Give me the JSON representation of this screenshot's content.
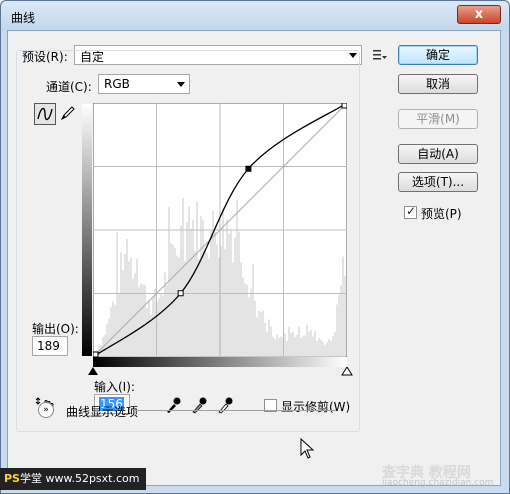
{
  "window": {
    "title": "曲线",
    "close_glyph": "x"
  },
  "preset": {
    "label": "预设(R):",
    "value": "自定"
  },
  "preset_menu_icon": "list-menu-icon",
  "channel": {
    "label": "通道(C):",
    "value": "RGB"
  },
  "buttons": {
    "ok": "确定",
    "cancel": "取消",
    "smooth": "平滑(M)",
    "auto": "自动(A)",
    "options": "选项(T)..."
  },
  "preview": {
    "label": "预览(P)",
    "checked": true
  },
  "output": {
    "label": "输出(O):",
    "value": "189"
  },
  "input": {
    "label": "输入(I):",
    "value": "156"
  },
  "show_clipping": {
    "label": "显示修剪(W)",
    "checked": false
  },
  "curve_display_options": {
    "label": "曲线显示选项"
  },
  "watermarks": {
    "left_ps": "PS",
    "left_rest": "学堂 www.52psxt.com",
    "right": "查字典 教程网",
    "right_sub": "jiaocheng.chazidian.com"
  },
  "curve": {
    "channel": "RGB",
    "range": [
      0,
      255
    ],
    "control_points": [
      [
        0,
        0
      ],
      [
        88,
        64
      ],
      [
        156,
        189
      ],
      [
        255,
        255
      ]
    ],
    "selected_point_index": 2
  }
}
